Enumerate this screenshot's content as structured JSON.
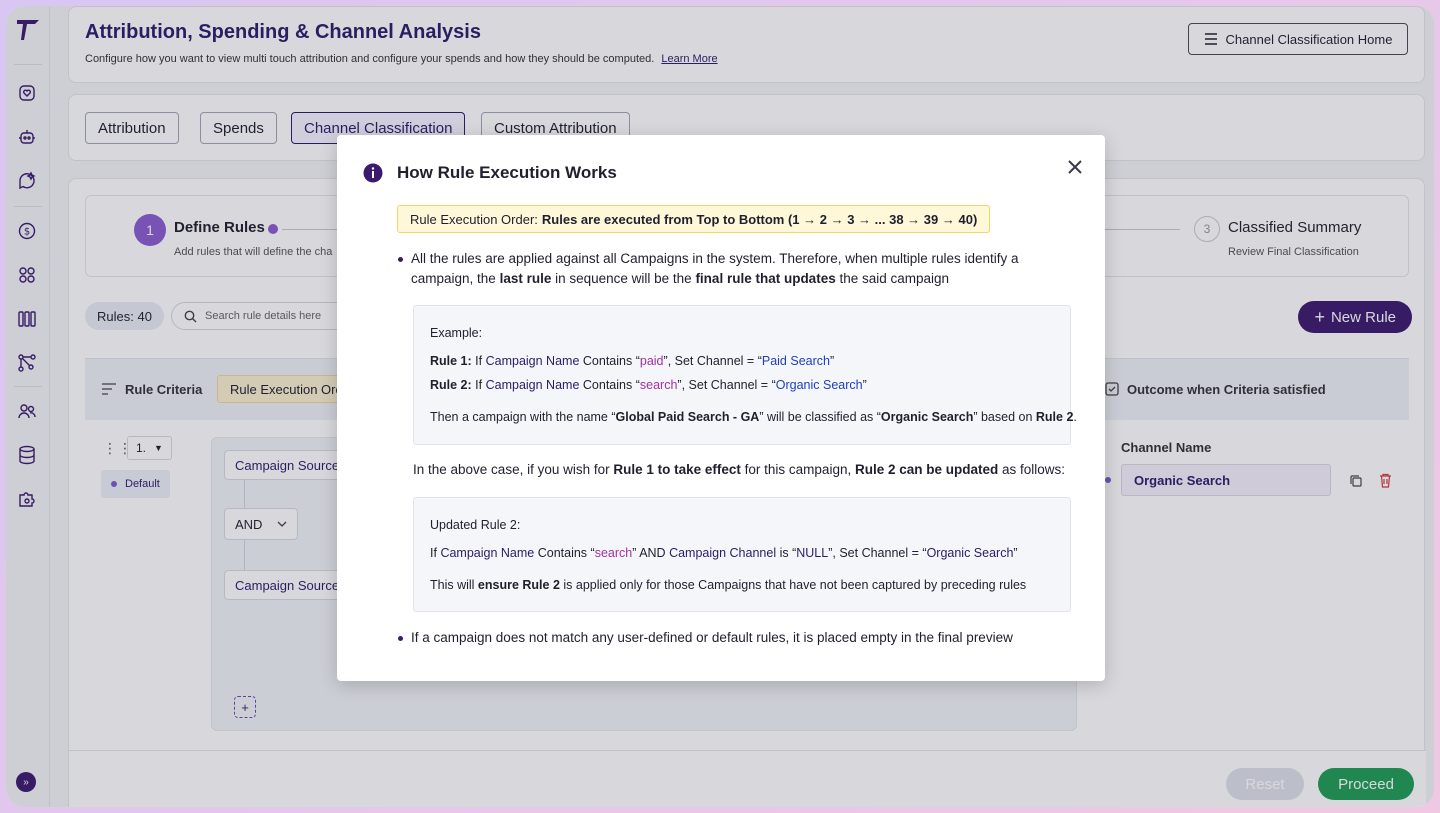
{
  "header": {
    "title": "Attribution, Spending & Channel Analysis",
    "subtitle": "Configure how you want to view multi touch attribution and configure your spends and how they should be computed.",
    "learn_more": "Learn More",
    "home_button": "Channel Classification Home"
  },
  "tabs": [
    "Attribution",
    "Spends",
    "Channel Classification",
    "Custom Attribution"
  ],
  "stepper": {
    "step1_num": "1",
    "step1_title": "Define Rules",
    "step1_desc": "Add rules that will define the cha",
    "step3_num": "3",
    "step3_title": "Classified Summary",
    "step3_desc": "Review Final Classification"
  },
  "toolbar": {
    "rules_count": "Rules: 40",
    "search_placeholder": "Search rule details here",
    "new_rule": "New Rule"
  },
  "table": {
    "rule_criteria": "Rule Criteria",
    "rule_execution_order": "Rule Execution Orc",
    "outcome": "Outcome when Criteria satisfied",
    "row_number": "1.",
    "default_tag": "Default",
    "field1": "Campaign Source",
    "operator": "AND",
    "field2": "Campaign Source",
    "channel_name_label": "Channel Name",
    "channel_value": "Organic Search"
  },
  "footer": {
    "reset": "Reset",
    "proceed": "Proceed"
  },
  "modal": {
    "title": "How Rule Execution Works",
    "order_label": "Rule Execution Order:",
    "order_value": "Rules are executed from Top to Bottom (1 → 2 → 3 → ... 38 → 39 → 40)",
    "bullet1_a": "All the rules are applied against all Campaigns in the system. Therefore, when multiple rules identify a campaign, the ",
    "bullet1_b": "last rule",
    "bullet1_c": " in sequence will be the ",
    "bullet1_d": "final rule that updates",
    "bullet1_e": " the said campaign",
    "example_label": "Example:",
    "rule1_label": "Rule 1:",
    "rule2_label": "Rule 2:",
    "if": "If",
    "campaign_name": "Campaign Name",
    "contains": "Contains",
    "paid": "paid",
    "search": "search",
    "set_channel": ", Set Channel =",
    "paid_search": "Paid Search",
    "organic_search": "Organic Search",
    "then_a": "Then a campaign with the name ",
    "then_b": "Global Paid Search - GA",
    "then_c": " will be classified as ",
    "then_d": "Organic Search",
    "then_e": " based on ",
    "then_f": "Rule 2",
    "mid_a": "In the above case, if you wish for ",
    "mid_b": "Rule 1 to take effect",
    "mid_c": " for this campaign, ",
    "mid_d": "Rule 2 can be updated",
    "mid_e": " as follows:",
    "updated_label": "Updated Rule 2:",
    "and": "AND",
    "campaign_channel": "Campaign Channel",
    "is": "is",
    "null_val": "NULL",
    "ensure_a": "This will ",
    "ensure_b": "ensure Rule 2",
    "ensure_c": " is applied only for those Campaigns that have not been captured by preceding rules",
    "bullet2": "If a campaign does not match any user-defined or default rules, it is placed empty in the final preview"
  }
}
